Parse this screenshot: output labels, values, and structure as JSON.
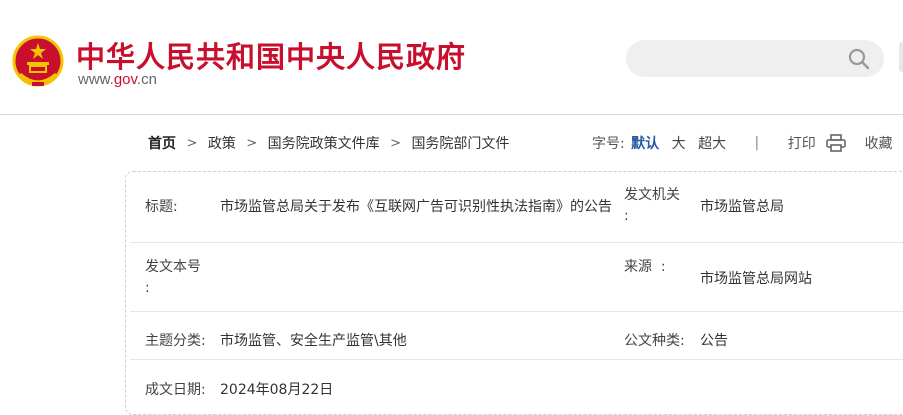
{
  "header": {
    "site_title": "中华人民共和国中央人民政府",
    "domain_prefix": "www.",
    "domain_highlight": "gov",
    "domain_suffix": ".cn",
    "search_placeholder": ""
  },
  "breadcrumb": [
    {
      "label": "首页"
    },
    {
      "label": "政策"
    },
    {
      "label": "国务院政策文件库"
    },
    {
      "label": "国务院部门文件"
    }
  ],
  "toolbar": {
    "font_size_label": "字号:",
    "font_default": "默认",
    "font_large": "大",
    "font_xlarge": "超大",
    "divider": "|",
    "print_label": "打印",
    "favorite_label": "收藏"
  },
  "document_info": {
    "title_label": "标题:",
    "title_value": "市场监管总局关于发布《互联网广告可识别性执法指南》的公告",
    "issuer_label_1": "发文机关",
    "issuer_label_2": ":",
    "issuer_value": "市场监管总局",
    "doc_number_label_1": "发文本号",
    "doc_number_label_2": ":",
    "doc_number_value": "",
    "source_label": "来源  :",
    "source_value": "市场监管总局网站",
    "subject_label": "主题分类:",
    "subject_value": "市场监管、安全生产监管\\其他",
    "doc_type_label": "公文种类:",
    "doc_type_value": "公告",
    "date_label": "成文日期:",
    "date_value": "2024年08月22日"
  },
  "colors": {
    "brand_red": "#c8102e",
    "link_blue": "#2759a5",
    "emblem_gold": "#f5c400"
  }
}
